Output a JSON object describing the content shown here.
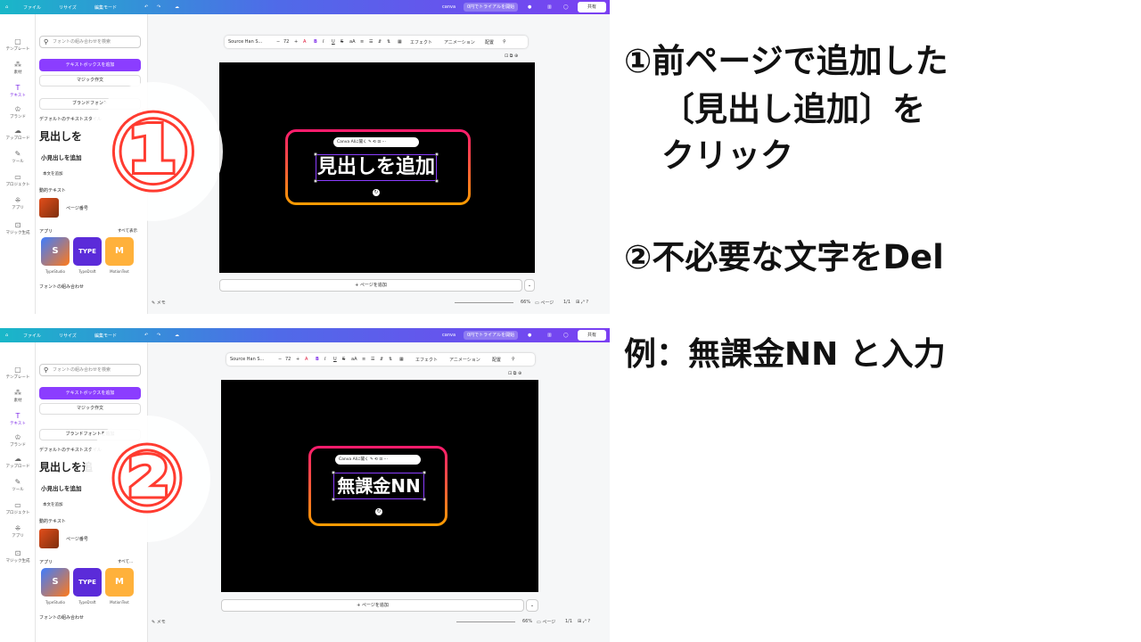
{
  "topbar": {
    "home": "⌂",
    "file": "ファイル",
    "resize": "リサイズ",
    "edit_mode": "編集モード",
    "brand": "canva",
    "trial": "0円でトライアルを開始",
    "share": "共有"
  },
  "nav": [
    {
      "icon": "template-icon",
      "glyph": "▢",
      "label": "テンプレート"
    },
    {
      "icon": "elements-icon",
      "glyph": "⁂",
      "label": "素材"
    },
    {
      "icon": "text-icon",
      "glyph": "T",
      "label": "テキスト"
    },
    {
      "icon": "brand-icon",
      "glyph": "♔",
      "label": "ブランド"
    },
    {
      "icon": "upload-icon",
      "glyph": "☁",
      "label": "アップロード"
    },
    {
      "icon": "draw-icon",
      "glyph": "✎",
      "label": "ツール"
    },
    {
      "icon": "folder-icon",
      "glyph": "▭",
      "label": "プロジェクト"
    },
    {
      "icon": "apps-icon",
      "glyph": "⁜",
      "label": "アプリ"
    },
    {
      "icon": "magic-icon",
      "glyph": "⊡",
      "label": "マジック生成"
    }
  ],
  "panel": {
    "search_placeholder": "フォントの組み合わせを検索",
    "add_textbox": "テキストボックスを追加",
    "magic_write": "マジック作文",
    "brand_font": "ブランドフォント",
    "brand_font_full": "ブランドフォントを追加",
    "default_styles": "デフォルトのテキストスタイル",
    "heading_short1": "見出しを",
    "heading_short2": "見出しを追",
    "subheading": "小見出しを追加",
    "body": "本文を追加",
    "dynamic_text": "動的テキスト",
    "page_number": "ページ番号",
    "apps": "アプリ",
    "see_all": "すべて表示",
    "see_all_short": "すべて...",
    "app1": "TypeStudio",
    "app2": "TypeDraft",
    "app3": "MotionText",
    "font_combos": "フォントの組み合わせ"
  },
  "toolbar": {
    "font": "Source Han S...",
    "size": "72",
    "effects": "エフェクト",
    "animate": "アニメーション",
    "position": "配置"
  },
  "canvas": {
    "text_before": "見出しを追加",
    "text_after": "無課金NN",
    "canva_ai": "Canva AIに聞く",
    "add_page": "+ ページを追加"
  },
  "footer": {
    "notes": "メモ",
    "zoom": "66%",
    "pages": "ページ",
    "page_count": "1/1"
  },
  "badges": [
    "①",
    "②"
  ],
  "instructions": {
    "step1_line1": "①前ページで追加した",
    "step1_line2": "〔見出し追加〕を",
    "step1_line3": "クリック",
    "step2": "②不必要な文字をDel",
    "example": "例：無課金NN と入力"
  },
  "colors": {
    "accent": "#8b3dff",
    "badge_red": "#ff3b30",
    "frame_top": "#ff1a6e",
    "frame_bottom": "#ff9d00"
  }
}
